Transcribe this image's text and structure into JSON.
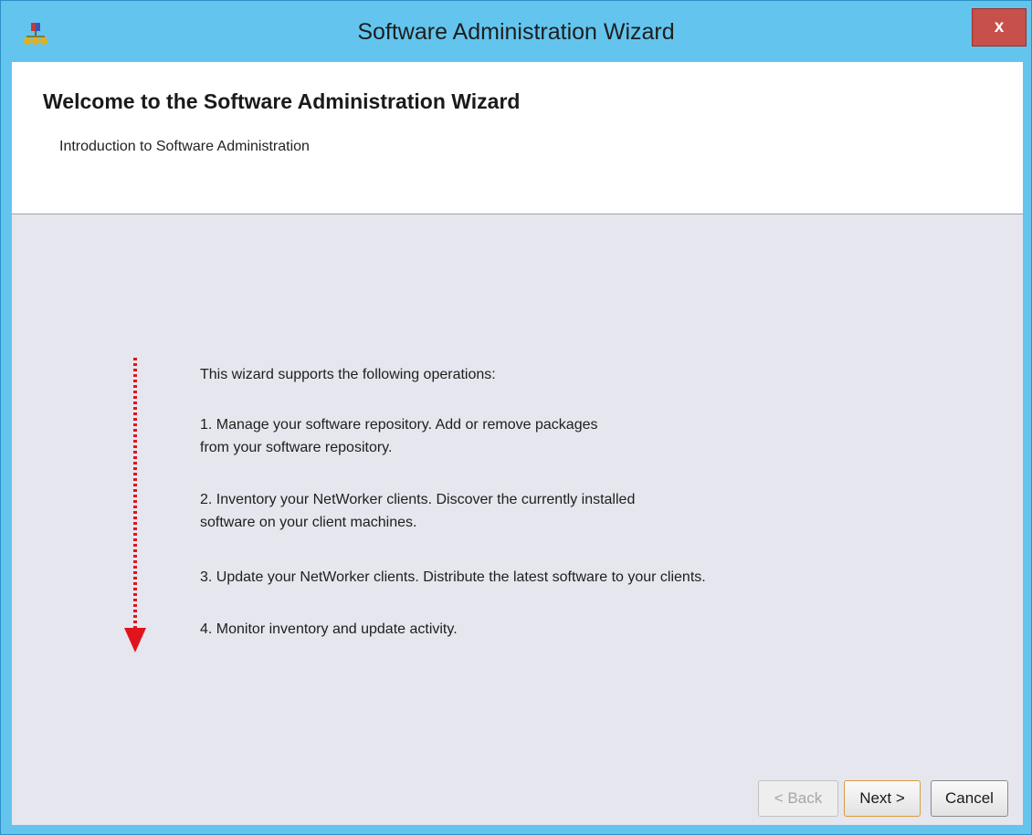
{
  "window": {
    "title": "Software Administration Wizard",
    "close_label": "x"
  },
  "header": {
    "title": "Welcome to the Software Administration Wizard",
    "subtitle": "Introduction to Software Administration"
  },
  "content": {
    "intro": "This wizard supports the following operations:",
    "items": [
      {
        "line1": "1. Manage your software repository. Add or remove packages",
        "line2": "from your software repository."
      },
      {
        "line1": "2. Inventory your NetWorker clients. Discover the currently installed",
        "line2": "software on your client machines."
      },
      {
        "line1": "3. Update your NetWorker clients. Distribute the latest software to your clients.",
        "line2": ""
      },
      {
        "line1": "4. Monitor inventory and update activity.",
        "line2": ""
      }
    ]
  },
  "buttons": {
    "back": "< Back",
    "next": "Next >",
    "cancel": "Cancel"
  },
  "colors": {
    "titlebar": "#63c5ee",
    "close": "#c7504a",
    "annotation_arrow": "#e0141c"
  },
  "icons": {
    "app": "networker-app-icon",
    "annotation": "dotted-down-arrow-icon"
  }
}
